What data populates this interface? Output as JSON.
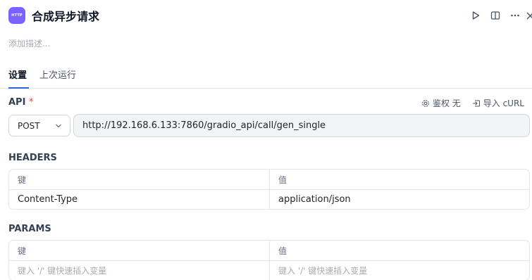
{
  "header": {
    "icon_text": "HTTP",
    "title": "合成异步请求",
    "actions": [
      "play-icon",
      "split-view-icon",
      "more-icon",
      "close-icon"
    ]
  },
  "description_placeholder": "添加描述...",
  "tabs": [
    {
      "label": "设置",
      "active": true
    },
    {
      "label": "上次运行",
      "active": false
    }
  ],
  "api": {
    "label": "API",
    "required_mark": "*",
    "auth_label": "鉴权 无",
    "import_label": "导入 cURL",
    "method": "POST",
    "url": "http://192.168.6.133:7860/gradio_api/call/gen_single"
  },
  "headers": {
    "label": "HEADERS",
    "key_header": "键",
    "value_header": "值",
    "rows": [
      {
        "key": "Content-Type",
        "value": "application/json"
      }
    ]
  },
  "params": {
    "label": "PARAMS",
    "key_header": "键",
    "value_header": "值",
    "key_placeholder": "键入 '/' 键快速插入变量",
    "value_placeholder": "键入 '/' 键快速插入变量"
  },
  "colors": {
    "accent": "#2563eb",
    "app_icon": "#7b61ff",
    "required": "#ef4444"
  }
}
